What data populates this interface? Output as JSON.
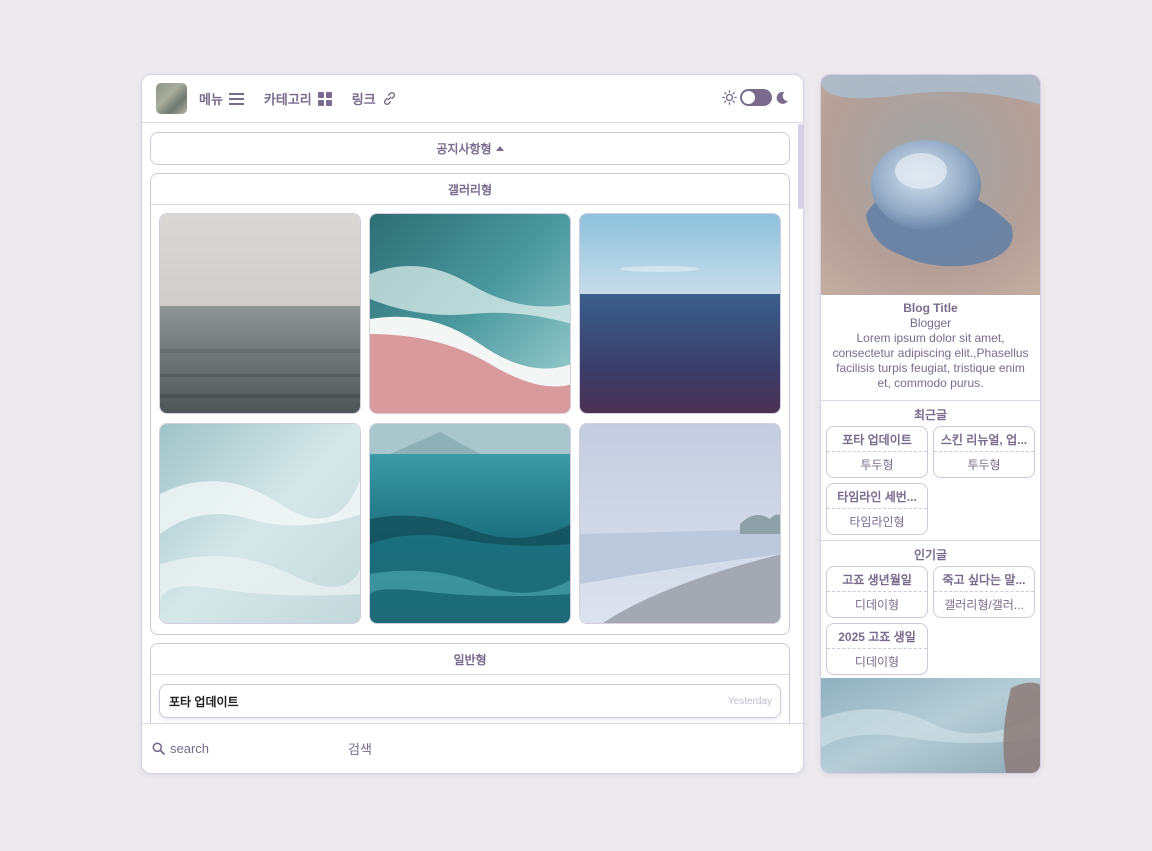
{
  "header": {
    "menu_label": "메뉴",
    "category_label": "카테고리",
    "link_label": "링크"
  },
  "sections": {
    "notice_title": "공지사항형",
    "gallery_title": "갤러리형",
    "general_title": "일반형"
  },
  "general_post": {
    "title": "포타 업데이트",
    "date": "Yesterday"
  },
  "search": {
    "placeholder": "search",
    "button_label": "검색"
  },
  "sidebar": {
    "blog_title": "Blog Title",
    "blogger": "Blogger",
    "description": "Lorem ipsum dolor sit amet, consectetur adipiscing elit.,Phasellus facilisis turpis feugiat, tristique enim et, commodo purus.",
    "recent_heading": "최근글",
    "recent_posts": [
      {
        "title": "포타 업데이트",
        "category": "투두형"
      },
      {
        "title": "스킨 리뉴얼, 업...",
        "category": "투두형"
      },
      {
        "title": "타임라인 세번...",
        "category": "타임라인형"
      }
    ],
    "popular_heading": "인기글",
    "popular_posts": [
      {
        "title": "고죠 생년월일",
        "category": "디데이형"
      },
      {
        "title": "죽고 싶다는 말...",
        "category": "갤러리형/갤러..."
      },
      {
        "title": "2025 고죠 생일",
        "category": "디데이형"
      }
    ]
  },
  "colors": {
    "accent": "#7a6b8e",
    "border": "#d7d0e2",
    "background": "#eceaee"
  }
}
